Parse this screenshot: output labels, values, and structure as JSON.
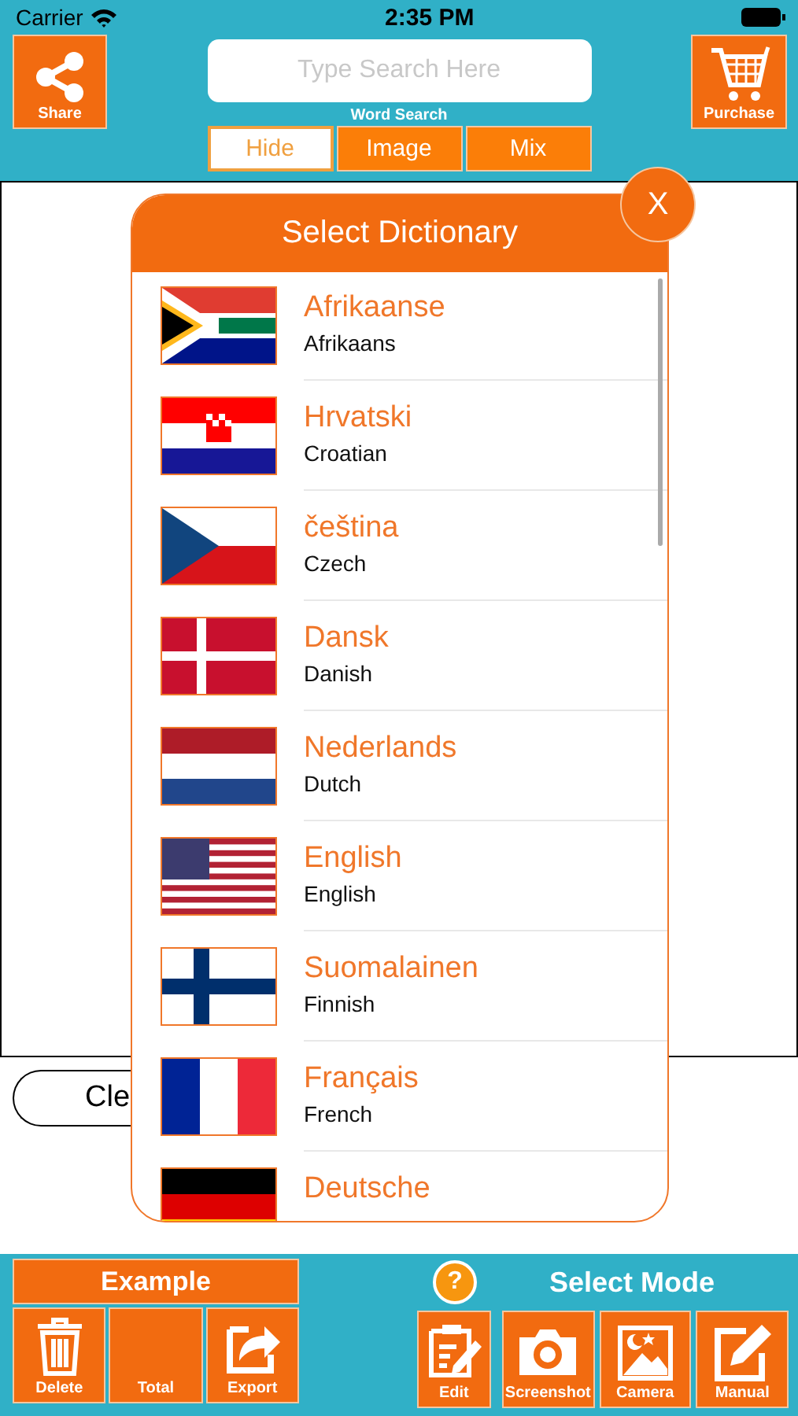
{
  "status_bar": {
    "carrier": "Carrier",
    "time": "2:35 PM"
  },
  "header": {
    "share": "Share",
    "search": {
      "placeholder": "Type Search Here"
    },
    "search_caption": "Word Search",
    "purchase": "Purchase",
    "tabs": [
      {
        "label": "Hide",
        "selected": true
      },
      {
        "label": "Image",
        "selected": false
      },
      {
        "label": "Mix",
        "selected": false
      }
    ]
  },
  "clear_button": "Cle",
  "dialog": {
    "title": "Select Dictionary",
    "close": "X",
    "items": [
      {
        "name": "Afrikaanse",
        "english": "Afrikaans"
      },
      {
        "name": "Hrvatski",
        "english": "Croatian"
      },
      {
        "name": "čeština",
        "english": "Czech"
      },
      {
        "name": "Dansk",
        "english": "Danish"
      },
      {
        "name": "Nederlands",
        "english": "Dutch"
      },
      {
        "name": "English",
        "english": "English"
      },
      {
        "name": "Suomalainen",
        "english": "Finnish"
      },
      {
        "name": "Français",
        "english": "French"
      },
      {
        "name": "Deutsche"
      }
    ]
  },
  "bottom": {
    "example": "Example",
    "left_buttons": [
      "Delete",
      "Total",
      "Export"
    ],
    "help": "?",
    "mode_title": "Select Mode",
    "mode_buttons": [
      "Edit",
      "Screenshot",
      "Camera",
      "Manual"
    ]
  }
}
